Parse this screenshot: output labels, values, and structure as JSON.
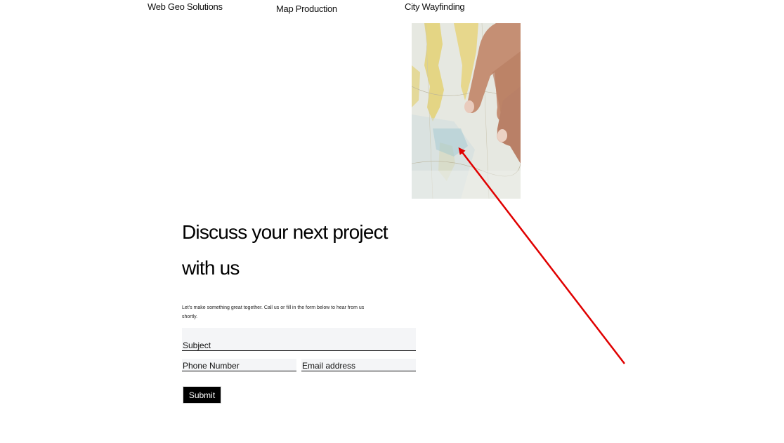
{
  "nav": {
    "items": [
      {
        "label": "Web Geo Solutions"
      },
      {
        "label": "Map Production"
      },
      {
        "label": "City Wayfinding"
      }
    ]
  },
  "contact": {
    "heading": "Discuss your next project with us",
    "intro": "Let's make something great together. Call us or fill in the form below to hear from us shortly.",
    "form": {
      "subject_placeholder": "Subject",
      "phone_placeholder": "Phone Number",
      "email_placeholder": "Email address",
      "submit_label": "Submit"
    }
  },
  "annotation": {
    "arrow_color": "#e00000"
  },
  "colors": {
    "field_bg": "#f4f5f7",
    "button_bg": "#000000",
    "button_text": "#ffffff"
  }
}
